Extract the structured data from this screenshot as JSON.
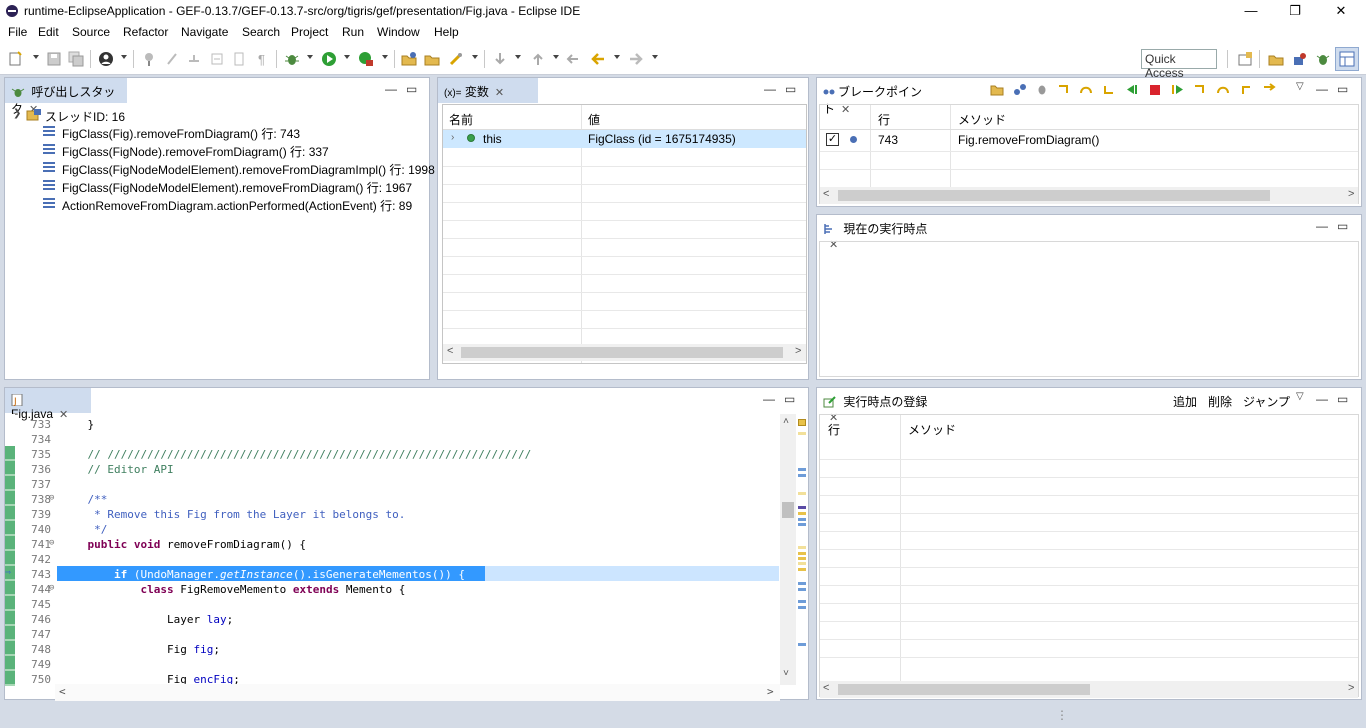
{
  "window": {
    "title": "runtime-EclipseApplication - GEF-0.13.7/GEF-0.13.7-src/org/tigris/gef/presentation/Fig.java - Eclipse IDE",
    "minimize": "—",
    "restore": "❐",
    "close": "✕"
  },
  "menu": [
    {
      "label": "File"
    },
    {
      "label": "Edit"
    },
    {
      "label": "Source"
    },
    {
      "label": "Refactor"
    },
    {
      "label": "Navigate"
    },
    {
      "label": "Search"
    },
    {
      "label": "Project"
    },
    {
      "label": "Run"
    },
    {
      "label": "Window"
    },
    {
      "label": "Help"
    }
  ],
  "toolbar": {
    "quick_access": "Quick Access"
  },
  "callstack": {
    "tab_label": "呼び出しスタック",
    "thread_label": "スレッドID: 16",
    "frames": [
      "FigClass(Fig).removeFromDiagram() 行: 743",
      "FigClass(FigNode).removeFromDiagram() 行: 337",
      "FigClass(FigNodeModelElement).removeFromDiagramImpl() 行: 1998",
      "FigClass(FigNodeModelElement).removeFromDiagram() 行: 1967",
      "ActionRemoveFromDiagram.actionPerformed(ActionEvent) 行: 89"
    ]
  },
  "variables": {
    "tab_prefix": "(x)=",
    "tab_label": "変数",
    "col_name": "名前",
    "col_value": "値",
    "rows": [
      {
        "name": "this",
        "value": "FigClass (id = 1675174935)"
      }
    ]
  },
  "breakpoints": {
    "tab_label": "ブレークポイント",
    "col_line": "行",
    "col_method": "メソッド",
    "rows": [
      {
        "line": "743",
        "method": "Fig.removeFromDiagram()"
      }
    ]
  },
  "current_exec": {
    "tab_label": "現在の実行時点"
  },
  "exec_register": {
    "tab_label": "実行時点の登録",
    "add": "追加",
    "delete": "削除",
    "jump": "ジャンプ",
    "col_line": "行",
    "col_method": "メソッド"
  },
  "editor": {
    "tab_label": "Fig.java",
    "current_line": "743",
    "lines": [
      {
        "n": "733"
      },
      {
        "n": "734"
      },
      {
        "n": "735"
      },
      {
        "n": "736"
      },
      {
        "n": "737"
      },
      {
        "n": "738"
      },
      {
        "n": "739"
      },
      {
        "n": "740"
      },
      {
        "n": "741"
      },
      {
        "n": "742"
      },
      {
        "n": "743"
      },
      {
        "n": "744"
      },
      {
        "n": "745"
      },
      {
        "n": "746"
      },
      {
        "n": "747"
      },
      {
        "n": "748"
      },
      {
        "n": "749"
      },
      {
        "n": "750"
      }
    ],
    "code": {
      "l733": "    }",
      "l735": "    // ////////////////////////////////////////////////////////////////",
      "l736": "    // Editor API",
      "l738": "    /**",
      "l739": "     * Remove this Fig from the Layer it belongs to.",
      "l740": "     */",
      "l741_kw": "public void ",
      "l741_rest": "removeFromDiagram() {",
      "l743_kw": "if ",
      "l743_a": "(UndoManager.",
      "l743_b": "getInstance",
      "l743_c": "().isGenerateMementos()) {",
      "l744_kw1": "class ",
      "l744_a": "FigRemoveMemento ",
      "l744_kw2": "extends ",
      "l744_b": "Memento {",
      "l746_a": "Layer ",
      "l746_b": "lay",
      "l746_c": ";",
      "l748_a": "Fig ",
      "l748_b": "fig",
      "l748_c": ";",
      "l750_a": "Fig ",
      "l750_b": "encFig",
      "l750_c": ";"
    }
  }
}
